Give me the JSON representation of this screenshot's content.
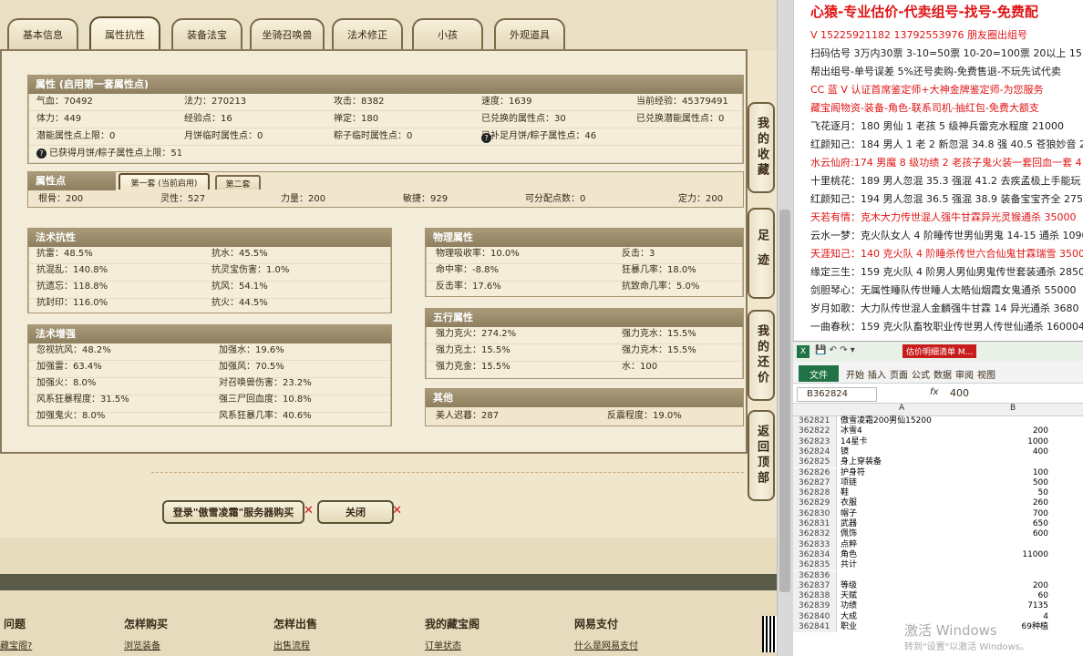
{
  "tabs": [
    "基本信息",
    "属性抗性",
    "装备法宝",
    "坐骑召唤兽",
    "法术修正",
    "小孩",
    "外观道具"
  ],
  "attr_section": {
    "title": "属性 (启用第一套属性点)",
    "rows": [
      [
        "气血：70492",
        "法力：270213",
        "攻击：8382",
        "速度：1639",
        "当前经验：45379491"
      ],
      [
        "体力：449",
        "经验点：16",
        "禅定：180",
        "已兑换的属性点：30",
        "已兑换潜能属性点：0"
      ],
      [
        "潜能属性点上限：0",
        "月饼临时属性点：0",
        "粽子临时属性点：0",
        "已补足月饼/粽子属性点：46",
        ""
      ]
    ],
    "note": "已获得月饼/粽子属性点上限：51"
  },
  "points_section": {
    "title": "属性点",
    "subtabs": [
      "第一套 (当前启用)",
      "第二套"
    ],
    "row": [
      "根骨：200",
      "灵性：527",
      "力量：200",
      "敏捷：929",
      "可分配点数：0",
      "定力：200"
    ]
  },
  "resist_section": {
    "title": "法术抗性",
    "rows": [
      [
        "抗雷：48.5%",
        "抗水：45.5%"
      ],
      [
        "抗混乱：140.8%",
        "抗灵宝伤害：1.0%"
      ],
      [
        "抗遗忘：118.8%",
        "抗风：54.1%"
      ],
      [
        "抗封印：116.0%",
        "抗火：44.5%"
      ]
    ]
  },
  "enhance_section": {
    "title": "法术增强",
    "rows": [
      [
        "忽视抗风：48.2%",
        "加强水：19.6%"
      ],
      [
        "加强雷：63.4%",
        "加强风：70.5%"
      ],
      [
        "加强火：8.0%",
        "对召唤兽伤害：23.2%"
      ],
      [
        "风系狂暴程度：31.5%",
        "强三尸回血度：10.8%"
      ],
      [
        "加强鬼火：8.0%",
        "风系狂暴几率：40.6%"
      ]
    ]
  },
  "physical_section": {
    "title": "物理属性",
    "rows": [
      [
        "物理吸收率：10.0%",
        "反击：3"
      ],
      [
        "命中率：-8.8%",
        "狂暴几率：18.0%"
      ],
      [
        "反击率：17.6%",
        "抗致命几率：5.0%"
      ]
    ]
  },
  "wuxing_section": {
    "title": "五行属性",
    "rows": [
      [
        "强力克火：274.2%",
        "强力克水：15.5%"
      ],
      [
        "强力克土：15.5%",
        "强力克木：15.5%"
      ],
      [
        "强力克金：15.5%",
        "水：100"
      ]
    ]
  },
  "other_section": {
    "title": "其他",
    "row": [
      "美人迟暮：287",
      "反震程度：19.0%"
    ]
  },
  "side_buttons": [
    "我的收藏",
    "足迹",
    "我的还价",
    "返回顶部"
  ],
  "buttons": {
    "login": "登录\"傲雪凌霜\"服务器购买",
    "close": "关闭"
  },
  "footer": {
    "titles": [
      "问题",
      "怎样购买",
      "怎样出售",
      "我的藏宝阁",
      "网易支付"
    ],
    "links": [
      "藏宝阁?",
      "浏览装备",
      "出售流程",
      "订单状态",
      "什么是网易支付"
    ]
  },
  "right_panel": {
    "lines": [
      {
        "t": "心猿-专业估价-代卖组号-找号-免费配",
        "c": "#e01515",
        "big": true
      },
      {
        "t": "V 15225921182   13792553976 朋友圈出组号",
        "c": "#e01515"
      },
      {
        "t": "扫码估号 3万内30票  3-10=50票  10-20=100票  20以上 15",
        "c": "#222"
      },
      {
        "t": "帮出组号-单号误差 5%还号卖购-免费售退-不玩先试代卖",
        "c": "#222"
      },
      {
        "t": "CC 蓝 V 认证首席鉴定师+大神金牌鉴定师-为您服务",
        "c": "#e01515"
      },
      {
        "t": "藏宝阁物资-装备-角色-联系司机-抽红包-免费大额支",
        "c": "#e01515"
      },
      {
        "t": "飞花逐月：180 男仙 1 老孩 5 级神兵雷克水程度 21000",
        "c": "#222"
      },
      {
        "t": "红颜知己：184 男人 1 老 2 新忽混 34.8 强 40.5 苍狼妙音 255",
        "c": "#222"
      },
      {
        "t": "水云仙府:174 男魔 8 级功绩 2 老孩子鬼火装一套回血一套 4",
        "c": "#e01515"
      },
      {
        "t": "十里桃花：189 男人忽混 35.3 强混 41.2 去疾孟极上手能玩 2",
        "c": "#222"
      },
      {
        "t": "红颜知己：194 男人忽混 36.5 强混 38.9 装备宝宝齐全 27500",
        "c": "#222"
      },
      {
        "t": "天若有情：克木大力传世混人强牛甘霖异光灵猴通杀 35000",
        "c": "#e01515"
      },
      {
        "t": "云水一梦：克火队女人 4 阶睡传世男仙男鬼 14-15 通杀 1090",
        "c": "#222"
      },
      {
        "t": "天涯知己：140 克火队 4 阶睡杀传世六合仙鬼甘霖瑞雪 3500",
        "c": "#e01515"
      },
      {
        "t": "缘定三生：159 克火队 4 阶男人男仙男鬼传世套装通杀 2850",
        "c": "#222"
      },
      {
        "t": "剑胆琴心：无属性睡队传世睡人太皓仙烟霞女鬼通杀 55000",
        "c": "#222"
      },
      {
        "t": "岁月如歌：大力队传世混人金麟强牛甘霖 14 异光通杀 3680",
        "c": "#222"
      },
      {
        "t": "一曲春秋：159 克火队畜牧职业传世男人传世仙通杀 160004",
        "c": "#222"
      }
    ]
  },
  "excel": {
    "title": "估价明细清单 M...",
    "ribbon_tabs": [
      "开始",
      "插入",
      "页面",
      "公式",
      "数据",
      "审阅",
      "视图"
    ],
    "file_tab": "文件",
    "name_box": "B362824",
    "formula": "400",
    "col_headers": [
      "A",
      "B"
    ],
    "rows": [
      [
        "362821",
        "傲雪凌霜200男仙15200",
        ""
      ],
      [
        "362822",
        "冰雪4",
        "200"
      ],
      [
        "362823",
        "14星卡",
        "1000"
      ],
      [
        "362824",
        "镜",
        "400"
      ],
      [
        "362825",
        "身上穿装备",
        ""
      ],
      [
        "362826",
        "护身符",
        "100"
      ],
      [
        "362827",
        "项链",
        "500"
      ],
      [
        "362828",
        "鞋",
        "50"
      ],
      [
        "362829",
        "衣服",
        "260"
      ],
      [
        "362830",
        "帽子",
        "700"
      ],
      [
        "362831",
        "武器",
        "650"
      ],
      [
        "362832",
        "佩饰",
        "600"
      ],
      [
        "362833",
        "点粹",
        ""
      ],
      [
        "362834",
        "角色",
        "11000"
      ],
      [
        "362835",
        "共计",
        ""
      ],
      [
        "362836",
        "",
        ""
      ],
      [
        "362837",
        "等级",
        "200"
      ],
      [
        "362838",
        "天赋",
        "60"
      ],
      [
        "362839",
        "功绩",
        "7135"
      ],
      [
        "362840",
        "大成",
        "4"
      ],
      [
        "362841",
        "职业",
        "69种植"
      ]
    ],
    "watermark1": "激活 Windows",
    "watermark2": "转到\"设置\"以激活 Windows。"
  }
}
